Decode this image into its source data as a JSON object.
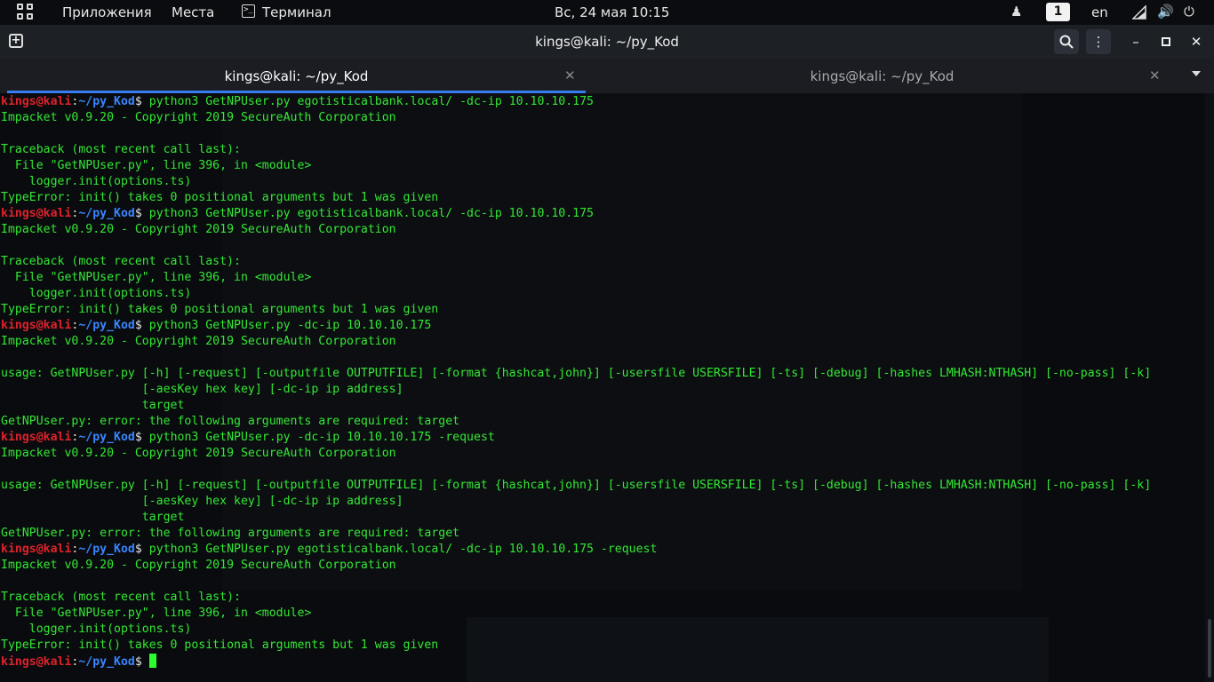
{
  "topbar": {
    "applications": "Приложения",
    "places": "Места",
    "terminal": "Терминал",
    "datetime": "Вс, 24 мая  10:15",
    "workspace": "1",
    "language": "en",
    "icons": [
      "apps-grid-icon",
      "terminal-icon",
      "people-icon",
      "network-icon",
      "volume-icon",
      "power-icon"
    ]
  },
  "window": {
    "title": "kings@kali: ~/py_Kod"
  },
  "tabs": [
    {
      "label": "kings@kali: ~/py_Kod",
      "active": true
    },
    {
      "label": "kings@kali: ~/py_Kod",
      "active": false
    }
  ],
  "colors": {
    "prompt_user": "#e0212b",
    "prompt_path": "#3a86ff",
    "output": "#33e833",
    "active_tab_underline": "#367bf0"
  },
  "terminal": {
    "prompt_user": "kings@kali",
    "prompt_path": "~/py_Kod",
    "lines": [
      {
        "type": "cmd",
        "text": "python3 GetNPUser.py egotisticalbank.local/ -dc-ip 10.10.10.175"
      },
      {
        "type": "out",
        "text": "Impacket v0.9.20 - Copyright 2019 SecureAuth Corporation"
      },
      {
        "type": "out",
        "text": ""
      },
      {
        "type": "out",
        "text": "Traceback (most recent call last):"
      },
      {
        "type": "out",
        "text": "  File \"GetNPUser.py\", line 396, in <module>"
      },
      {
        "type": "out",
        "text": "    logger.init(options.ts)"
      },
      {
        "type": "out",
        "text": "TypeError: init() takes 0 positional arguments but 1 was given"
      },
      {
        "type": "cmd",
        "text": "python3 GetNPUser.py egotisticalbank.local/ -dc-ip 10.10.10.175"
      },
      {
        "type": "out",
        "text": "Impacket v0.9.20 - Copyright 2019 SecureAuth Corporation"
      },
      {
        "type": "out",
        "text": ""
      },
      {
        "type": "out",
        "text": "Traceback (most recent call last):"
      },
      {
        "type": "out",
        "text": "  File \"GetNPUser.py\", line 396, in <module>"
      },
      {
        "type": "out",
        "text": "    logger.init(options.ts)"
      },
      {
        "type": "out",
        "text": "TypeError: init() takes 0 positional arguments but 1 was given"
      },
      {
        "type": "cmd",
        "text": "python3 GetNPUser.py -dc-ip 10.10.10.175"
      },
      {
        "type": "out",
        "text": "Impacket v0.9.20 - Copyright 2019 SecureAuth Corporation"
      },
      {
        "type": "out",
        "text": ""
      },
      {
        "type": "out",
        "text": "usage: GetNPUser.py [-h] [-request] [-outputfile OUTPUTFILE] [-format {hashcat,john}] [-usersfile USERSFILE] [-ts] [-debug] [-hashes LMHASH:NTHASH] [-no-pass] [-k]"
      },
      {
        "type": "out",
        "text": "                    [-aesKey hex key] [-dc-ip ip address]"
      },
      {
        "type": "out",
        "text": "                    target"
      },
      {
        "type": "out",
        "text": "GetNPUser.py: error: the following arguments are required: target"
      },
      {
        "type": "cmd",
        "text": "python3 GetNPUser.py -dc-ip 10.10.10.175 -request"
      },
      {
        "type": "out",
        "text": "Impacket v0.9.20 - Copyright 2019 SecureAuth Corporation"
      },
      {
        "type": "out",
        "text": ""
      },
      {
        "type": "out",
        "text": "usage: GetNPUser.py [-h] [-request] [-outputfile OUTPUTFILE] [-format {hashcat,john}] [-usersfile USERSFILE] [-ts] [-debug] [-hashes LMHASH:NTHASH] [-no-pass] [-k]"
      },
      {
        "type": "out",
        "text": "                    [-aesKey hex key] [-dc-ip ip address]"
      },
      {
        "type": "out",
        "text": "                    target"
      },
      {
        "type": "out",
        "text": "GetNPUser.py: error: the following arguments are required: target"
      },
      {
        "type": "cmd",
        "text": "python3 GetNPUser.py egotisticalbank.local/ -dc-ip 10.10.10.175 -request"
      },
      {
        "type": "out",
        "text": "Impacket v0.9.20 - Copyright 2019 SecureAuth Corporation"
      },
      {
        "type": "out",
        "text": ""
      },
      {
        "type": "out",
        "text": "Traceback (most recent call last):"
      },
      {
        "type": "out",
        "text": "  File \"GetNPUser.py\", line 396, in <module>"
      },
      {
        "type": "out",
        "text": "    logger.init(options.ts)"
      },
      {
        "type": "out",
        "text": "TypeError: init() takes 0 positional arguments but 1 was given"
      },
      {
        "type": "prompt",
        "text": ""
      }
    ]
  }
}
